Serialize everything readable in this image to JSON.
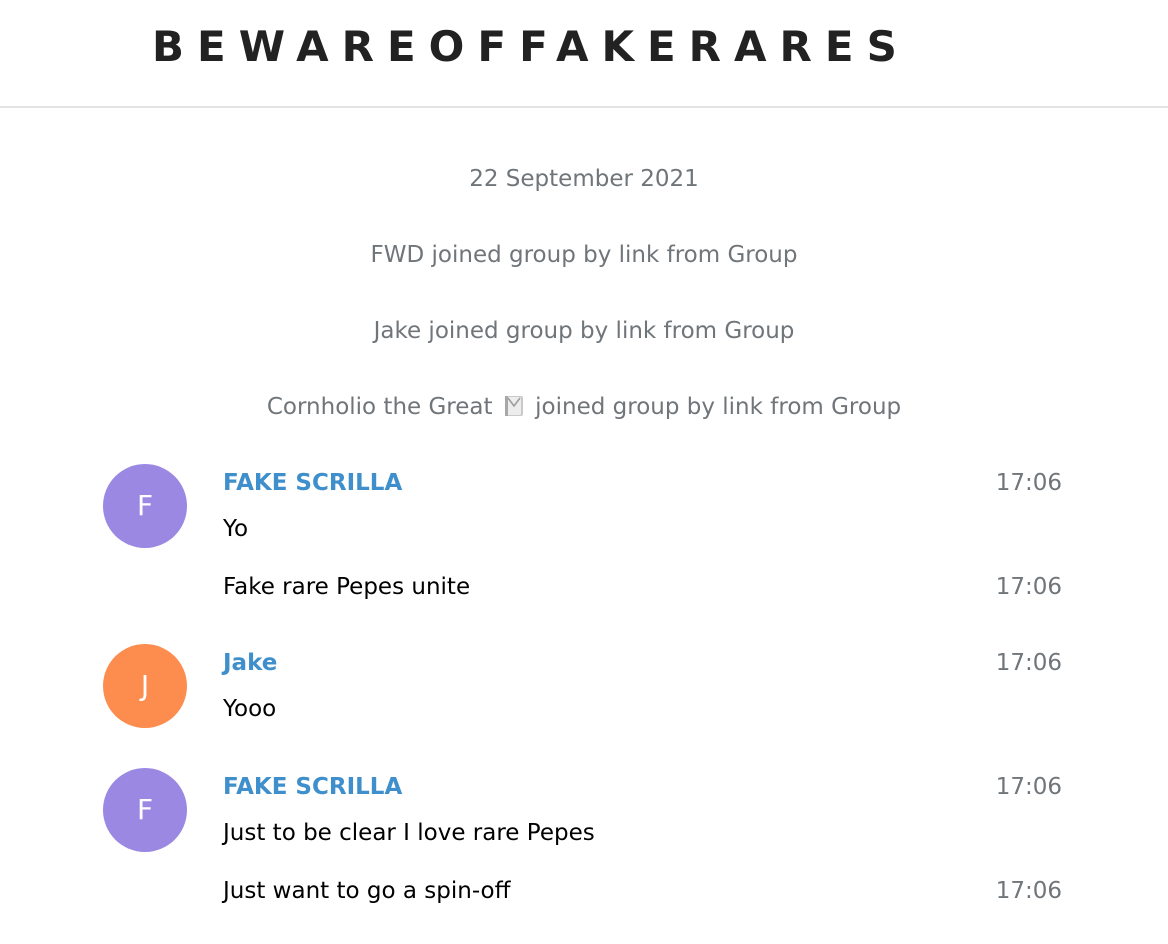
{
  "header": {
    "title": "BEWAREOFFAKERARES"
  },
  "date_separator": "22 September 2021",
  "service_messages": [
    {
      "text": "FWD joined group by link from Group"
    },
    {
      "text": "Jake joined group by link from Group"
    },
    {
      "name": "Cornholio the Great",
      "icon": "book-emoji",
      "rest": "joined group by link from Group"
    }
  ],
  "messages": [
    {
      "sender": "FAKE SCRILLA",
      "initial": "F",
      "avatar_color": "#9b88e3",
      "lines": [
        {
          "text": "Yo",
          "time": "17:06"
        },
        {
          "text": "Fake rare Pepes unite",
          "time": "17:06"
        }
      ]
    },
    {
      "sender": "Jake",
      "initial": "J",
      "avatar_color": "#fd8c4f",
      "lines": [
        {
          "text": "Yooo",
          "time": "17:06"
        }
      ]
    },
    {
      "sender": "FAKE SCRILLA",
      "initial": "F",
      "avatar_color": "#9b88e3",
      "lines": [
        {
          "text": "Just to be clear I love rare Pepes",
          "time": "17:06"
        },
        {
          "text": "Just want to go a spin-off",
          "time": "17:06"
        }
      ]
    }
  ],
  "colors": {
    "sender_name": "#3f8fcc",
    "service_text": "#70757a",
    "header_text": "#222222",
    "divider": "#e3e3e3"
  }
}
